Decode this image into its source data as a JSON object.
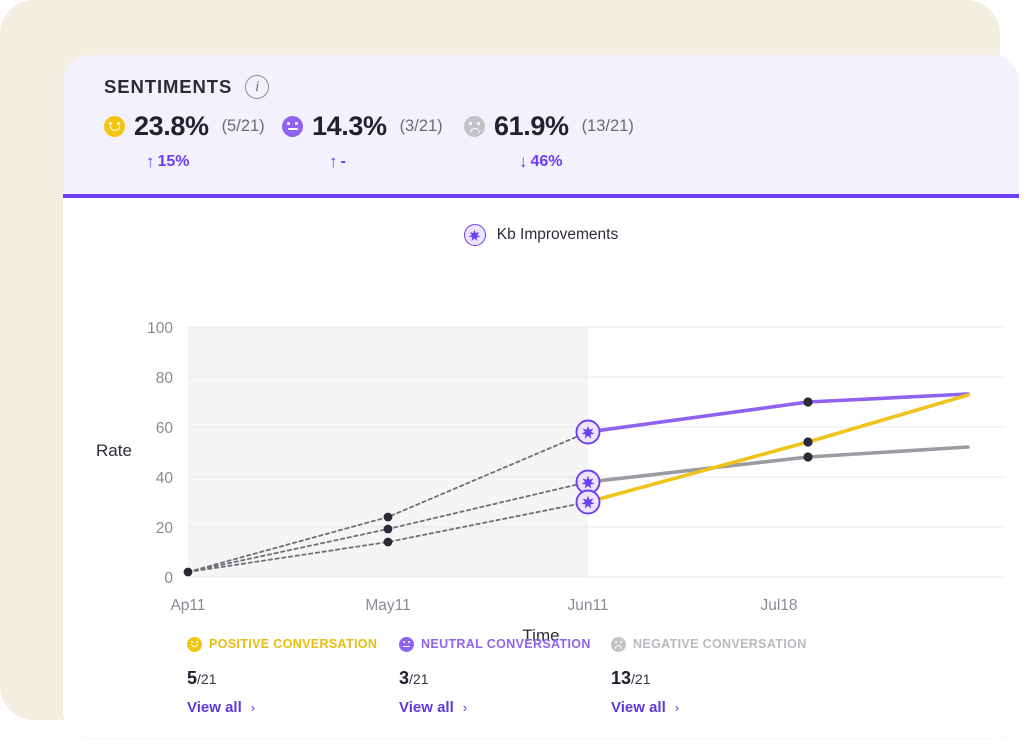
{
  "header": {
    "title": "SENTIMENTS",
    "info_icon": "info-icon",
    "stats": [
      {
        "icon": "smiley-happy-icon",
        "tone": "pos",
        "percent": "23.8%",
        "fraction": "(5/21)",
        "delta_arrow": "↑",
        "delta_value": "15%"
      },
      {
        "icon": "smiley-neutral-icon",
        "tone": "neu",
        "percent": "14.3%",
        "fraction": "(3/21)",
        "delta_arrow": "↑",
        "delta_value": "-"
      },
      {
        "icon": "smiley-sad-icon",
        "tone": "neg",
        "percent": "61.9%",
        "fraction": "(13/21)",
        "delta_arrow": "↓",
        "delta_value": "46%"
      }
    ]
  },
  "series_legend": {
    "marker_icon": "kb-improvement-marker-icon",
    "label": "Kb Improvements"
  },
  "bottom_legend": {
    "columns": [
      {
        "tone": "pos",
        "icon": "smiley-happy-icon",
        "label": "POSITIVE CONVERSATION",
        "count": "5",
        "denominator": "/21",
        "link": "View all",
        "chevron": "›"
      },
      {
        "tone": "neu",
        "icon": "smiley-neutral-icon",
        "label": "NEUTRAL CONVERSATION",
        "count": "3",
        "denominator": "/21",
        "link": "View all",
        "chevron": "›"
      },
      {
        "tone": "neg",
        "icon": "smiley-sad-icon",
        "label": "NEGATIVE CONVERSATION",
        "count": "13",
        "denominator": "/21",
        "link": "View all",
        "chevron": "›"
      }
    ]
  },
  "colors": {
    "accent_purple": "#6b3ef0",
    "positive_yellow": "#efc31a",
    "neutral_purple": "#8f63f0",
    "negative_gray": "#9b9ba3",
    "header_bg": "#f4f1fe",
    "backdrop": "#f2efe0",
    "card": "#ffffff"
  },
  "chart_data": {
    "type": "line",
    "title": "",
    "xlabel": "Time",
    "ylabel": "Rate",
    "ylim": [
      0,
      100
    ],
    "yticks": [
      0,
      20,
      40,
      60,
      80,
      100
    ],
    "categories": [
      "Ap11",
      "May11",
      "Jun11",
      "Jul18",
      ""
    ],
    "grid": true,
    "legend_position": "top-center",
    "shaded_region": {
      "from": "Ap11",
      "to": "Jun11",
      "label": "past-period"
    },
    "marker_annotation": {
      "at": "Jun11",
      "label": "Kb Improvements"
    },
    "series": [
      {
        "name": "Neutral conversation",
        "color": "#8f63f0",
        "x": [
          "Ap11",
          "May11",
          "Jun11",
          "Jul18",
          ""
        ],
        "values": [
          2,
          24,
          58,
          70,
          73
        ],
        "style_before_event": "dotted",
        "style_after_event": "solid"
      },
      {
        "name": "Negative conversation",
        "color": "#9b9ba3",
        "x": [
          "Ap11",
          "May11",
          "Jun11",
          "Jul18",
          ""
        ],
        "values": [
          2,
          19,
          38,
          48,
          52
        ],
        "style_before_event": "dotted",
        "style_after_event": "solid"
      },
      {
        "name": "Positive conversation",
        "color": "#efc31a",
        "x": [
          "Ap11",
          "May11",
          "Jun11",
          "Jul18",
          ""
        ],
        "values": [
          2,
          14,
          30,
          54,
          71
        ],
        "style_before_event": "dotted",
        "style_after_event": "solid"
      }
    ]
  }
}
